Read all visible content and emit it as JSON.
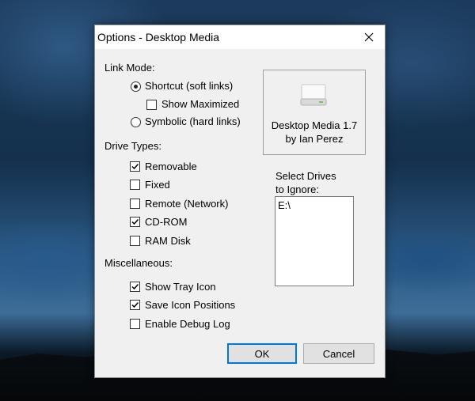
{
  "dialog": {
    "title": "Options - Desktop Media",
    "link_mode": {
      "label": "Link Mode:",
      "options": [
        {
          "label": "Shortcut (soft links)",
          "selected": true
        },
        {
          "label": "Symbolic (hard links)",
          "selected": false
        }
      ],
      "show_maximized": {
        "label": "Show Maximized",
        "checked": false
      }
    },
    "drive_types": {
      "label": "Drive Types:",
      "items": [
        {
          "label": "Removable",
          "checked": true
        },
        {
          "label": "Fixed",
          "checked": false
        },
        {
          "label": "Remote (Network)",
          "checked": false
        },
        {
          "label": "CD-ROM",
          "checked": true
        },
        {
          "label": "RAM Disk",
          "checked": false
        }
      ]
    },
    "misc": {
      "label": "Miscellaneous:",
      "items": [
        {
          "label": "Show Tray Icon",
          "checked": true
        },
        {
          "label": "Save Icon Positions",
          "checked": true
        },
        {
          "label": "Enable Debug Log",
          "checked": false
        }
      ]
    },
    "about": {
      "name": "Desktop Media 1.7",
      "author": "by Ian Perez",
      "icon": "drive-icon"
    },
    "ignore": {
      "label_line1": "Select Drives",
      "label_line2": "to Ignore:",
      "items": [
        "E:\\"
      ]
    },
    "buttons": {
      "ok": "OK",
      "cancel": "Cancel"
    },
    "colors": {
      "accent": "#0078d7",
      "dialog_bg": "#f0f0f0"
    }
  }
}
